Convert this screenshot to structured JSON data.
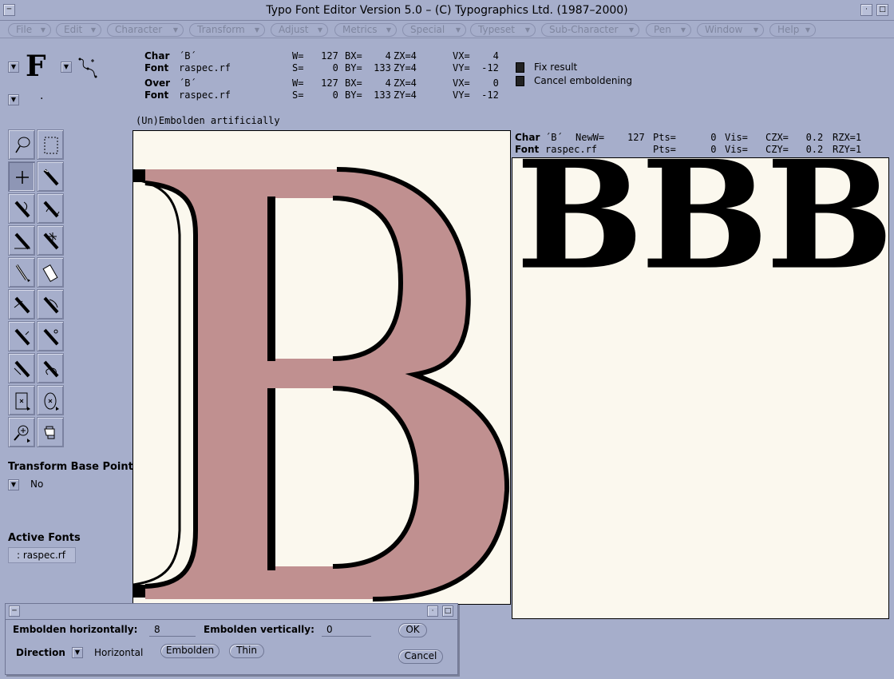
{
  "window": {
    "title": "Typo Font Editor Version 5.0 – (C) Typographics Ltd. (1987–2000)"
  },
  "menubar": {
    "items": [
      "File",
      "Edit",
      "Character",
      "Transform",
      "Adjust",
      "Metrics",
      "Special",
      "Typeset",
      "Sub-Character",
      "Pen",
      "Window",
      "Help"
    ]
  },
  "glyph_preview": {
    "letter": "F",
    "dot": "."
  },
  "info": {
    "row1": {
      "label": "Char",
      "value": "´B´",
      "w": "W=   127",
      "bx": "BX=    4",
      "zx": "ZX=4",
      "vx": "VX=    4"
    },
    "row2": {
      "label": "Font",
      "value": "raspec.rf",
      "s": "S=     0",
      "by": "BY=  133",
      "zy": "ZY=4",
      "vy": "VY=  -12"
    },
    "row3": {
      "label": "Over",
      "value": "´B´",
      "w": "W=   127",
      "bx": "BX=    4",
      "zx": "ZX=4",
      "vx": "VX=    0"
    },
    "row4": {
      "label": "Font",
      "value": "raspec.rf",
      "s": "S=     0",
      "by": "BY=  133",
      "zy": "ZY=4",
      "vy": "VY=  -12"
    }
  },
  "options": {
    "fix_result": "Fix result",
    "cancel_emboldening": "Cancel emboldening"
  },
  "operation_label": "(Un)Embolden artificially",
  "tools": [
    "lasso-tool",
    "marquee-select-tool",
    "crosshair-tool",
    "pen-tool",
    "pen-curve-tool",
    "pen-scribble-tool",
    "pen-segment-tool",
    "pen-star-tool",
    "pencil-tool",
    "eraser-tool",
    "pen-cut-tool",
    "pen-branch-tool",
    "pen-arrow-tool",
    "pen-node-tool",
    "pen-join-tool",
    "pen-loop-tool",
    "rect-node-tool",
    "ellipse-node-tool",
    "zoom-tool",
    "hand-tool"
  ],
  "transform_base_point": {
    "heading": "Transform Base Point",
    "value": "No"
  },
  "active_fonts": {
    "heading": "Active Fonts",
    "item": ": raspec.rf"
  },
  "preview_info": {
    "row1": {
      "label": "Char",
      "value": "´B´",
      "neww": "NewW=    127",
      "pts": "Pts=      0",
      "vis": "Vis=",
      "czx": "CZX=   0.2",
      "rzx": "RZX=1"
    },
    "row2": {
      "label": "Font",
      "value": "raspec.rf",
      "pts": "Pts=      0",
      "vis": "Vis=",
      "czy": "CZY=   0.2",
      "rzy": "RZY=1"
    }
  },
  "preview_text": "BBB",
  "dialog": {
    "embolden_h_label": "Embolden horizontally:",
    "embolden_h_value": "8",
    "embolden_v_label": "Embolden vertically:",
    "embolden_v_value": "0",
    "ok": "OK",
    "direction_label": "Direction",
    "direction_value": "Horizontal",
    "embolden_button": "Embolden",
    "thin_button": "Thin",
    "cancel": "Cancel"
  },
  "colors": {
    "window_bg": "#a6aecb",
    "canvas_bg": "#fbf8ee",
    "glyph_fill": "#c09090",
    "ink": "#000000"
  }
}
